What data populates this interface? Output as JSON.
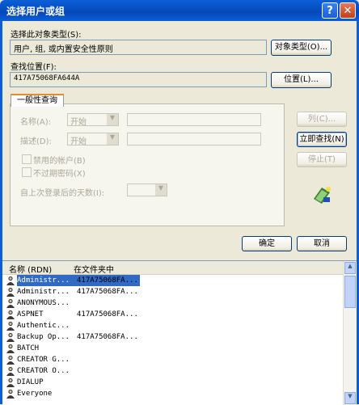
{
  "window": {
    "title": "选择用户或组"
  },
  "object_type": {
    "label": "选择此对象类型(S):",
    "value": "用户, 组, 或内置安全性原则",
    "button": "对象类型(O)..."
  },
  "location": {
    "label": "查找位置(F):",
    "value": "417A75068FA644A",
    "button": "位置(L)..."
  },
  "query": {
    "tab": "一般性查询",
    "name_label": "名称(A):",
    "name_combo": "开始",
    "desc_label": "描述(D):",
    "desc_combo": "开始",
    "disabled_accounts": "禁用的帐户(B)",
    "no_expire_password": "不过期密码(X)",
    "days_label": "自上次登录后的天数(I):",
    "columns_button": "列(C)...",
    "find_now_button": "立即查找(N)",
    "stop_button": "停止(T)"
  },
  "actions": {
    "ok": "确定",
    "cancel": "取消"
  },
  "results": {
    "columns": [
      "名称 (RDN)",
      "在文件夹中"
    ],
    "rows": [
      {
        "name": "Administr...",
        "folder": "417A75068FA..."
      },
      {
        "name": "Administr...",
        "folder": "417A75068FA..."
      },
      {
        "name": "ANONYMOUS...",
        "folder": ""
      },
      {
        "name": "ASPNET",
        "folder": "417A75068FA..."
      },
      {
        "name": "Authentic...",
        "folder": ""
      },
      {
        "name": "Backup Op...",
        "folder": "417A75068FA..."
      },
      {
        "name": "BATCH",
        "folder": ""
      },
      {
        "name": "CREATOR G...",
        "folder": ""
      },
      {
        "name": "CREATOR O...",
        "folder": ""
      },
      {
        "name": "DIALUP",
        "folder": ""
      },
      {
        "name": "Everyone",
        "folder": ""
      }
    ]
  }
}
